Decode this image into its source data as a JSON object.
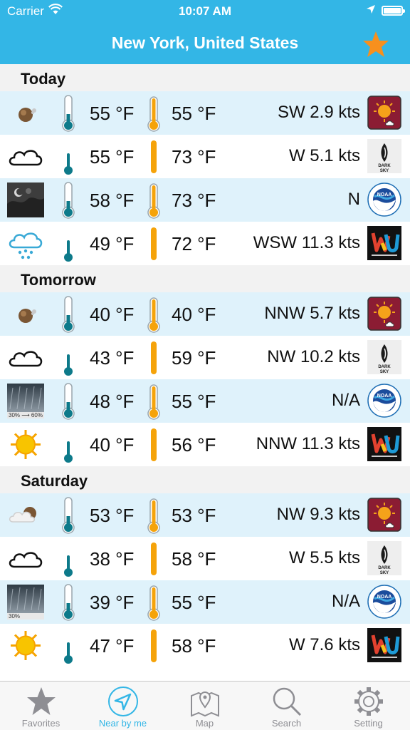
{
  "status": {
    "carrier": "Carrier",
    "time": "10:07 AM"
  },
  "header": {
    "title": "New York, United States"
  },
  "sections": [
    {
      "title": "Today",
      "rows": [
        {
          "hi": "55 °F",
          "lo": "55 °F",
          "wind": "SW 2.9 kts",
          "condition": "moon-cloud-icon",
          "source": "sun-cloud-logo"
        },
        {
          "hi": "55 °F",
          "lo": "73 °F",
          "wind": "W 5.1 kts",
          "condition": "cloud-icon",
          "source": "dark-sky-logo"
        },
        {
          "hi": "58 °F",
          "lo": "73 °F",
          "wind": "N",
          "condition": "night-photo-icon",
          "source": "noaa-logo"
        },
        {
          "hi": "49 °F",
          "lo": "72 °F",
          "wind": "WSW 11.3 kts",
          "condition": "rain-cloud-icon",
          "source": "wunderground-logo"
        }
      ]
    },
    {
      "title": "Tomorrow",
      "rows": [
        {
          "hi": "40 °F",
          "lo": "40 °F",
          "wind": "NNW 5.7 kts",
          "condition": "moon-cloud-icon",
          "source": "sun-cloud-logo"
        },
        {
          "hi": "43 °F",
          "lo": "59 °F",
          "wind": "NW 10.2 kts",
          "condition": "cloud-icon",
          "source": "dark-sky-logo"
        },
        {
          "hi": "48 °F",
          "lo": "55 °F",
          "wind": "N/A",
          "condition": "rain-photo-icon",
          "source": "noaa-logo",
          "photo_text": "30% ⟶ 60%"
        },
        {
          "hi": "40 °F",
          "lo": "56 °F",
          "wind": "NNW 11.3 kts",
          "condition": "sun-icon",
          "source": "wunderground-logo"
        }
      ]
    },
    {
      "title": "Saturday",
      "rows": [
        {
          "hi": "53 °F",
          "lo": "53 °F",
          "wind": "NW 9.3 kts",
          "condition": "sun-behind-cloud-icon",
          "source": "sun-cloud-logo"
        },
        {
          "hi": "38 °F",
          "lo": "58 °F",
          "wind": "W 5.5 kts",
          "condition": "cloud-icon",
          "source": "dark-sky-logo"
        },
        {
          "hi": "39 °F",
          "lo": "55 °F",
          "wind": "N/A",
          "condition": "rain-photo-icon",
          "source": "noaa-logo",
          "photo_text": "30%"
        },
        {
          "hi": "47 °F",
          "lo": "58 °F",
          "wind": "W 7.6 kts",
          "condition": "sun-icon",
          "source": "wunderground-logo"
        }
      ]
    }
  ],
  "tabs": [
    {
      "label": "Favorites",
      "icon": "star-icon",
      "active": false
    },
    {
      "label": "Near by me",
      "icon": "location-arrow-icon",
      "active": true
    },
    {
      "label": "Map",
      "icon": "map-icon",
      "active": false
    },
    {
      "label": "Search",
      "icon": "search-icon",
      "active": false
    },
    {
      "label": "Setting",
      "icon": "gear-icon",
      "active": false
    }
  ],
  "colors": {
    "accent": "#33b6e6",
    "favorite_star": "#f7901e",
    "thermometer_teal": "#0d7a8a",
    "thermometer_orange": "#f5a30a",
    "alt_row": "#dff2fb"
  }
}
